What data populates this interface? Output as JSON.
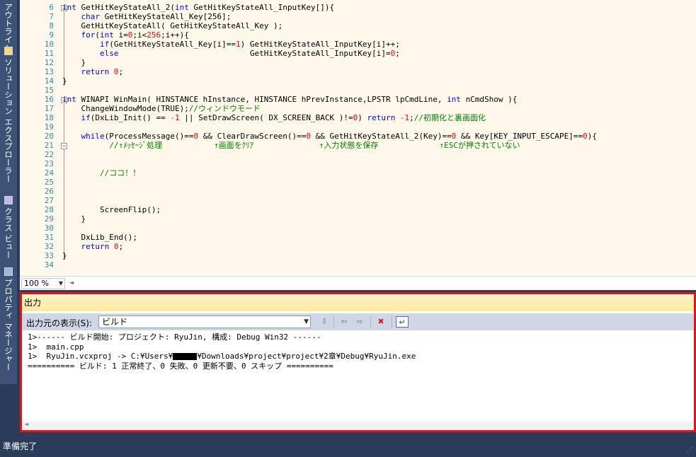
{
  "side_tabs": [
    {
      "label": "アウトライン",
      "icon": "outline-icon"
    },
    {
      "label": "ソリューション エクスプローラー",
      "icon": "solution-explorer-icon"
    },
    {
      "label": "クラス ビュー",
      "icon": "class-view-icon"
    },
    {
      "label": "プロパティ マネージャー",
      "icon": "property-manager-icon"
    }
  ],
  "editor": {
    "line_numbers": [
      "6",
      "7",
      "8",
      "9",
      "10",
      "11",
      "12",
      "13",
      "14",
      "15",
      "16",
      "17",
      "18",
      "19",
      "20",
      "21",
      "22",
      "23",
      "24",
      "25",
      "26",
      "27",
      "28",
      "29",
      "30",
      "31",
      "32",
      "33",
      "34"
    ],
    "code_lines": [
      [
        {
          "t": "int ",
          "c": "kw"
        },
        {
          "t": "GetHitKeyStateAll_2(",
          "c": ""
        },
        {
          "t": "int ",
          "c": "kw"
        },
        {
          "t": "GetHitKeyStateAll_InputKey[]){",
          "c": ""
        }
      ],
      [
        {
          "t": "    char ",
          "c": "kw"
        },
        {
          "t": "GetHitKeyStateAll_Key[256];",
          "c": ""
        }
      ],
      [
        {
          "t": "    GetHitKeyStateAll( GetHitKeyStateAll_Key );",
          "c": ""
        }
      ],
      [
        {
          "t": "    for",
          "c": "kw"
        },
        {
          "t": "(",
          "c": ""
        },
        {
          "t": "int ",
          "c": "kw"
        },
        {
          "t": "i=",
          "c": ""
        },
        {
          "t": "0",
          "c": "nm"
        },
        {
          "t": ";i<",
          "c": ""
        },
        {
          "t": "256",
          "c": "nm"
        },
        {
          "t": ";i++){",
          "c": ""
        }
      ],
      [
        {
          "t": "        if",
          "c": "kw"
        },
        {
          "t": "(GetHitKeyStateAll_Key[i]==",
          "c": ""
        },
        {
          "t": "1",
          "c": "nm"
        },
        {
          "t": ") GetHitKeyStateAll_InputKey[i]++;",
          "c": ""
        }
      ],
      [
        {
          "t": "        else",
          "c": "kw"
        },
        {
          "t": "                            GetHitKeyStateAll_InputKey[i]=",
          "c": ""
        },
        {
          "t": "0",
          "c": "nm"
        },
        {
          "t": ";",
          "c": ""
        }
      ],
      [
        {
          "t": "    }",
          "c": ""
        }
      ],
      [
        {
          "t": "    return ",
          "c": "kw"
        },
        {
          "t": "0",
          "c": "nm"
        },
        {
          "t": ";",
          "c": ""
        }
      ],
      [
        {
          "t": "}",
          "c": ""
        }
      ],
      [],
      [
        {
          "t": "int ",
          "c": "kw"
        },
        {
          "t": "WINAPI WinMain( HINSTANCE hInstance, HINSTANCE hPrevInstance,LPSTR lpCmdLine, ",
          "c": ""
        },
        {
          "t": "int ",
          "c": "kw"
        },
        {
          "t": "nCmdShow ){",
          "c": ""
        }
      ],
      [
        {
          "t": "    ChangeWindowMode(TRUE);",
          "c": ""
        },
        {
          "t": "//ウィンドウモード",
          "c": "cm"
        }
      ],
      [
        {
          "t": "    if",
          "c": "kw"
        },
        {
          "t": "(DxLib_Init() == ",
          "c": ""
        },
        {
          "t": "-1",
          "c": "nm"
        },
        {
          "t": " || SetDrawScreen( DX_SCREEN_BACK )!=",
          "c": ""
        },
        {
          "t": "0",
          "c": "nm"
        },
        {
          "t": ") ",
          "c": ""
        },
        {
          "t": "return ",
          "c": "kw"
        },
        {
          "t": "-1",
          "c": "nm"
        },
        {
          "t": ";",
          "c": ""
        },
        {
          "t": "//初期化と裏画面化",
          "c": "cm"
        }
      ],
      [],
      [
        {
          "t": "    while",
          "c": "kw"
        },
        {
          "t": "(ProcessMessage()==",
          "c": ""
        },
        {
          "t": "0",
          "c": "nm"
        },
        {
          "t": " && ClearDrawScreen()==",
          "c": ""
        },
        {
          "t": "0",
          "c": "nm"
        },
        {
          "t": " && GetHitKeyStateAll_2(Key)==",
          "c": ""
        },
        {
          "t": "0",
          "c": "nm"
        },
        {
          "t": " && Key[KEY_INPUT_ESCAPE]==",
          "c": ""
        },
        {
          "t": "0",
          "c": "nm"
        },
        {
          "t": "){",
          "c": ""
        }
      ],
      [
        {
          "t": "          //↑ﾒｯｾｰｼﾞ処理           ↑画面をｸﾘｱ              ↑入力状態を保存             ↑ESCが押されていない",
          "c": "cm"
        }
      ],
      [],
      [],
      [
        {
          "t": "        //ココ！！",
          "c": "cm"
        }
      ],
      [],
      [],
      [],
      [
        {
          "t": "        ScreenFlip();",
          "c": ""
        }
      ],
      [
        {
          "t": "    }",
          "c": ""
        }
      ],
      [],
      [
        {
          "t": "    DxLib_End();",
          "c": ""
        }
      ],
      [
        {
          "t": "    return ",
          "c": "kw"
        },
        {
          "t": "0",
          "c": "nm"
        },
        {
          "t": ";",
          "c": ""
        }
      ],
      [
        {
          "t": "}",
          "c": ""
        }
      ],
      []
    ]
  },
  "zoom": {
    "value": "100 %"
  },
  "output": {
    "title": "出力",
    "show_label": "出力元の表示(S):",
    "source_value": "ビルド",
    "lines": {
      "l1": "1>------ ビルド開始: プロジェクト: RyuJin, 構成: Debug Win32 ------",
      "l2": "1>  main.cpp",
      "l3_pre": "1>  RyuJin.vcxproj -> C:¥Users¥",
      "l3_post": "¥Downloads¥project¥project¥2章¥Debug¥RyuJin.exe",
      "l4": "========== ビルド: 1 正常終了、0 失敗、0 更新不要、0 スキップ =========="
    }
  },
  "status": {
    "text": "準備完了"
  },
  "colors": {
    "keyword": "#0000ff",
    "comment": "#008000",
    "number": "#ff0000",
    "highlight_border": "#e0141e"
  }
}
